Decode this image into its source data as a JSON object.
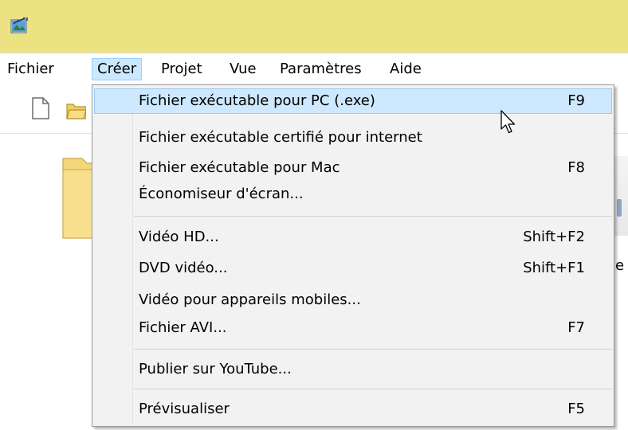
{
  "menubar": {
    "items": [
      {
        "label": "Fichier"
      },
      {
        "label": "Créer"
      },
      {
        "label": "Projet"
      },
      {
        "label": "Vue"
      },
      {
        "label": "Paramètres"
      },
      {
        "label": "Aide"
      }
    ],
    "active_index": 1
  },
  "icons": {
    "app": "app-logo-icon",
    "toolbar": [
      "new-document-icon",
      "open-folder-icon"
    ],
    "cursor": "mouse-pointer-icon"
  },
  "background": {
    "fragment_text": "e"
  },
  "dropdown": {
    "items": [
      {
        "label": "Fichier exécutable pour PC (.exe)",
        "shortcut": "F9",
        "highlighted": true
      },
      {
        "label": "Fichier exécutable certifié pour internet",
        "shortcut": ""
      },
      {
        "label": "Fichier exécutable pour Mac",
        "shortcut": "F8"
      },
      {
        "label": "Économiseur d'écran...",
        "shortcut": ""
      },
      {
        "label": "Vidéo HD...",
        "shortcut": "Shift+F2"
      },
      {
        "label": "DVD vidéo...",
        "shortcut": "Shift+F1"
      },
      {
        "label": "Vidéo pour appareils mobiles...",
        "shortcut": ""
      },
      {
        "label": "Fichier AVI...",
        "shortcut": "F7"
      },
      {
        "label": "Publier sur YouTube...",
        "shortcut": ""
      },
      {
        "label": "Prévisualiser",
        "shortcut": "F5"
      }
    ]
  },
  "colors": {
    "titlebar": "#ede282",
    "menu_highlight": "#cce8ff",
    "menu_highlight_border": "#99d1ff",
    "dropdown_bg": "#f2f2f2"
  }
}
